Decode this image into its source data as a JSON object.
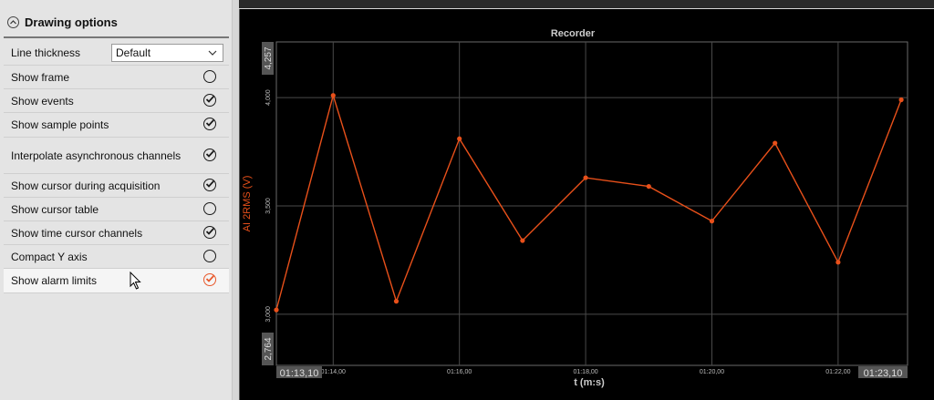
{
  "panel": {
    "title": "Drawing options",
    "line_thickness_label": "Line thickness",
    "line_thickness_value": "Default",
    "options": [
      {
        "label": "Show frame",
        "checked": false
      },
      {
        "label": "Show events",
        "checked": true
      },
      {
        "label": "Show sample points",
        "checked": true
      },
      {
        "label": "Interpolate asynchronous channels",
        "checked": true
      },
      {
        "label": "Show cursor during acquisition",
        "checked": true
      },
      {
        "label": "Show cursor table",
        "checked": false
      },
      {
        "label": "Show time cursor channels",
        "checked": true
      },
      {
        "label": "Compact Y axis",
        "checked": false
      },
      {
        "label": "Show alarm limits",
        "checked": true,
        "accent": "#e8582b"
      }
    ]
  },
  "chart_data": {
    "type": "line",
    "title": "Recorder",
    "xlabel": "t (m:s)",
    "ylabel": "AI 2RMS (V)",
    "y_min_label": "2,764",
    "y_max_label": "4,257",
    "x_min_label": "01:13,10",
    "x_max_label": "01:23,10",
    "ylim": [
      2.764,
      4.257
    ],
    "xlim": [
      73.1,
      83.1
    ],
    "y_ticks": [
      {
        "v": 3.0,
        "label": "3,000"
      },
      {
        "v": 3.5,
        "label": "3,500"
      },
      {
        "v": 4.0,
        "label": "4,000"
      }
    ],
    "x_ticks": [
      {
        "v": 74.0,
        "label": "01:14,00"
      },
      {
        "v": 76.0,
        "label": "01:16,00"
      },
      {
        "v": 78.0,
        "label": "01:18,00"
      },
      {
        "v": 80.0,
        "label": "01:20,00"
      },
      {
        "v": 82.0,
        "label": "01:22,00"
      }
    ],
    "x_gridlines": [
      74.0,
      76.0,
      78.0,
      80.0,
      82.0
    ],
    "series": [
      {
        "color": "#e8501a",
        "x": [
          73.1,
          74.0,
          75.0,
          76.0,
          77.0,
          78.0,
          79.0,
          80.0,
          81.0,
          82.0,
          83.0
        ],
        "y": [
          3.02,
          4.01,
          3.06,
          3.81,
          3.34,
          3.63,
          3.59,
          3.43,
          3.79,
          3.24,
          3.99
        ]
      }
    ],
    "colors": {
      "background": "#000000",
      "grid": "#4a4a4a",
      "axis_label": "#e8501a",
      "title": "#cccccc"
    }
  }
}
